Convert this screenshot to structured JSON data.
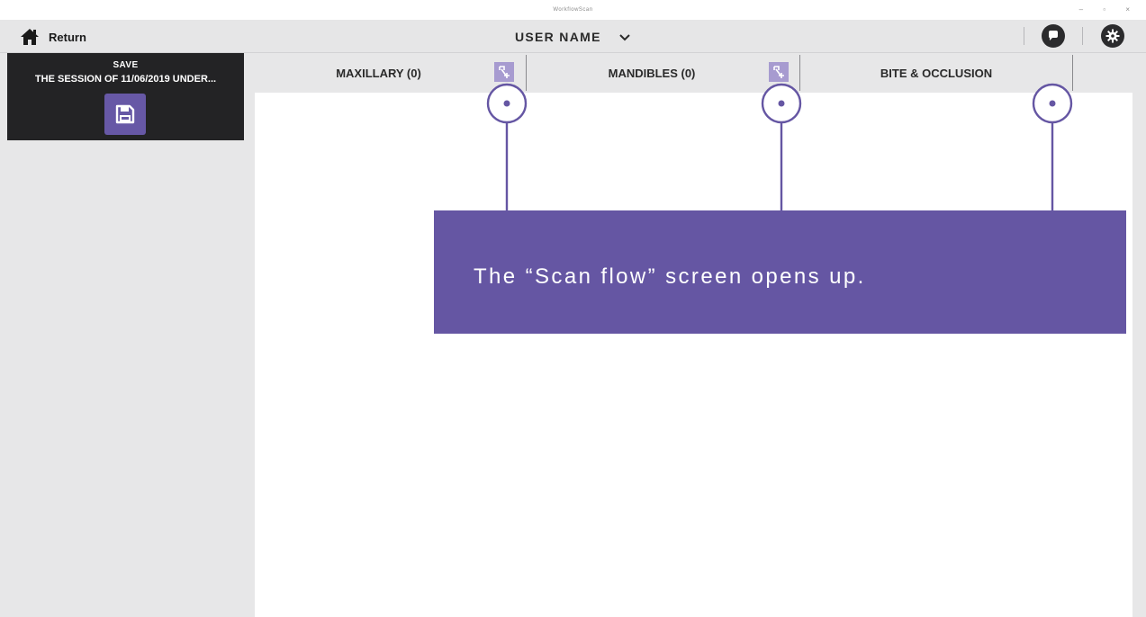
{
  "window": {
    "app_title": "WorkflowScan",
    "controls": [
      "–",
      "▫",
      "×"
    ]
  },
  "appbar": {
    "return_label": "Return",
    "user_name": "USER NAME",
    "icons": {
      "home": "home-icon",
      "chevron": "chevron-down-icon",
      "chat": "chat-bubble-icon",
      "settings": "gear-icon"
    }
  },
  "sidebar": {
    "save_title": "SAVE",
    "save_subtitle": "THE SESSION OF 11/06/2019 UNDER...",
    "save_icon": "floppy-disk-icon"
  },
  "tabs": [
    {
      "label": "MAXILLARY (0)",
      "action_icon": "add-scan-icon"
    },
    {
      "label": "MANDIBLES (0)",
      "action_icon": "add-scan-icon"
    },
    {
      "label": "BITE & OCCLUSION"
    }
  ],
  "callout": {
    "text": "The “Scan flow” screen opens up."
  },
  "colors": {
    "accent_purple": "#6556a3",
    "button_purple": "#6758a6",
    "icon_tile_purple": "#a79bd0",
    "dark_panel": "#232325",
    "toolbar_gray": "#e6e6e7"
  }
}
